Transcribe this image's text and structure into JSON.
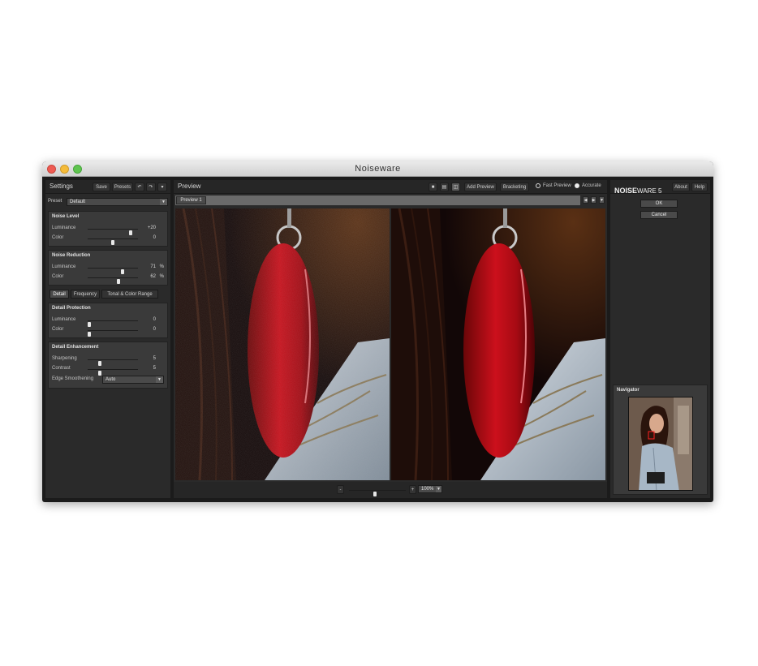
{
  "window": {
    "title": "Noiseware"
  },
  "settings": {
    "title": "Settings",
    "save_label": "Save",
    "presets_label": "Presets",
    "preset_label": "Preset",
    "preset_value": "Default",
    "noise_level": {
      "title": "Noise Level",
      "rows": [
        {
          "label": "Luminance",
          "value": "+20",
          "unit": "",
          "level": 0.88
        },
        {
          "label": "Color",
          "value": "0",
          "unit": "",
          "level": 0.5
        }
      ]
    },
    "noise_reduction": {
      "title": "Noise Reduction",
      "rows": [
        {
          "label": "Luminance",
          "value": "71",
          "unit": "%",
          "level": 0.71
        },
        {
          "label": "Color",
          "value": "62",
          "unit": "%",
          "level": 0.62
        }
      ]
    },
    "tabs": [
      "Detail",
      "Frequency",
      "Tonal & Color Range"
    ],
    "detail_protection": {
      "title": "Detail Protection",
      "rows": [
        {
          "label": "Luminance",
          "value": "0",
          "unit": "",
          "level": 0.0
        },
        {
          "label": "Color",
          "value": "0",
          "unit": "",
          "level": 0.0
        }
      ]
    },
    "detail_enhancement": {
      "title": "Detail Enhancement",
      "rows": [
        {
          "label": "Sharpening",
          "value": "5",
          "unit": "",
          "level": 0.22
        },
        {
          "label": "Contrast",
          "value": "5",
          "unit": "",
          "level": 0.22
        }
      ],
      "edge_smoothing_label": "Edge Smoothening",
      "edge_smoothing_value": "Auto"
    }
  },
  "preview": {
    "title": "Preview",
    "add_preview_label": "Add Preview",
    "bracketing_label": "Bracketing",
    "fast_preview_label": "Fast Preview",
    "accurate_label": "Accurate",
    "tab_label": "Preview 1",
    "zoom_value": "100%",
    "zoom_level": 0.45
  },
  "right": {
    "brand_prefix": "NOISE",
    "brand_suffix": "WARE 5",
    "about_label": "About",
    "help_label": "Help",
    "ok_label": "OK",
    "cancel_label": "Cancel",
    "navigator_title": "Navigator"
  }
}
